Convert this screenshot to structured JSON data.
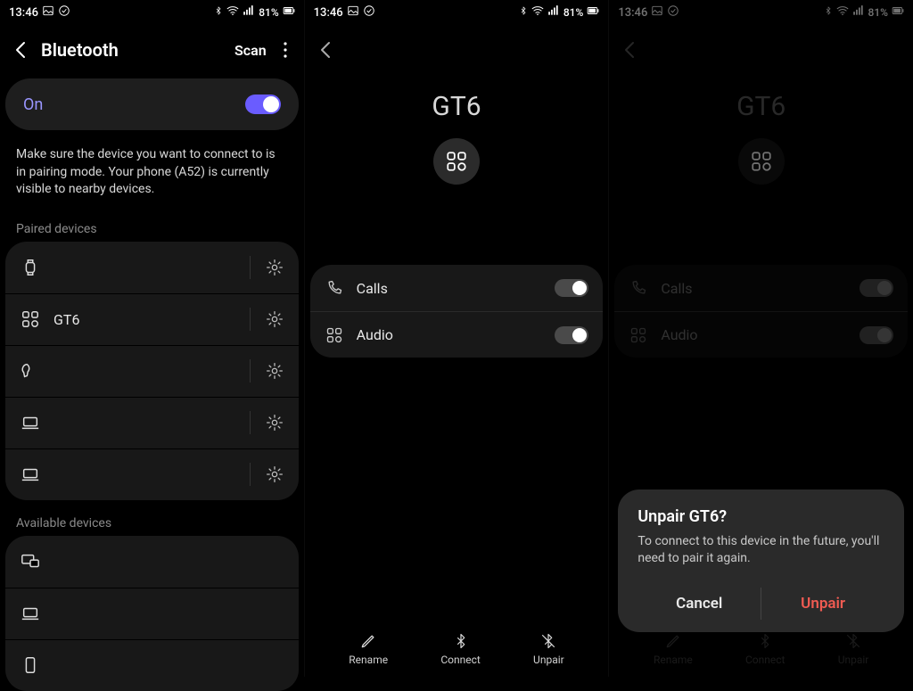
{
  "status": {
    "time": "13:46",
    "battery_text": "81%"
  },
  "panel1": {
    "title": "Bluetooth",
    "scan_label": "Scan",
    "on_label": "On",
    "hint": "Make sure the device you want to connect to is in pairing mode. Your phone (A52) is currently visible to nearby devices.",
    "paired_label": "Paired devices",
    "available_label": "Available devices",
    "paired": [
      {
        "icon": "watch",
        "name": ""
      },
      {
        "icon": "widget",
        "name": "GT6"
      },
      {
        "icon": "buds",
        "name": ""
      },
      {
        "icon": "laptop",
        "name": ""
      },
      {
        "icon": "laptop",
        "name": ""
      }
    ]
  },
  "panel2": {
    "device_name": "GT6",
    "features": {
      "calls": "Calls",
      "audio": "Audio"
    },
    "actions": {
      "rename": "Rename",
      "connect": "Connect",
      "unpair": "Unpair"
    }
  },
  "panel3": {
    "device_name": "GT6",
    "features": {
      "calls": "Calls",
      "audio": "Audio"
    },
    "actions": {
      "rename": "Rename",
      "connect": "Connect",
      "unpair": "Unpair"
    },
    "dialog": {
      "title": "Unpair GT6?",
      "message": "To connect to this device in the future, you'll need to pair it again.",
      "cancel": "Cancel",
      "unpair": "Unpair"
    }
  }
}
